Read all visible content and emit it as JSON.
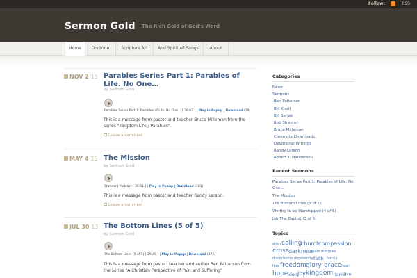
{
  "topbar": {
    "follow": "Follow:",
    "rss": "RSS"
  },
  "header": {
    "title": "Sermon Gold",
    "tagline": "The Rich Gold of God's Word"
  },
  "nav": [
    "Home",
    "Doctrine",
    "Scripture Art",
    "And Spiritual Songs",
    "About"
  ],
  "posts": [
    {
      "month": "NOV 2",
      "day": "15",
      "title": "Parables Series Part 1: Parables of Life. No One…",
      "byline": "by Sermon Gold",
      "player_text": "Parables Series Part 1: Parables of Life. No One…  [ 36:02 ]",
      "play_popup": "Play in Popup",
      "download": "Download",
      "downloads": "(39)",
      "excerpt": "This is a message from pastor and teacher Bruce Milleman from the series \"Kingdom Life / Parables\".",
      "comment": "Leave a comment"
    },
    {
      "month": "MAY 4",
      "day": "15",
      "title": "The Mission",
      "byline": "by Sermon Gold",
      "player_text": "Standard Podcast  [ 36:51 ]",
      "play_popup": "Play in Popup",
      "download": "Download",
      "downloads": "(103)",
      "excerpt": "This is a message from pastor and teacher Randy Larson.",
      "comment": "Leave a comment"
    },
    {
      "month": "JUL 30",
      "day": "13",
      "title": "The Bottom Lines (5 of 5)",
      "byline": "by Sermon Gold",
      "player_text": "The Bottom Lines (5 of 5)  [ 29:49 ]",
      "play_popup": "Play in Popup",
      "download": "Download",
      "downloads": "(176)",
      "excerpt": "This is a message from pastor, teacher and author Ben Patterson from the series \"A Christian Perspective of Pain and Suffering\"",
      "comment": ""
    }
  ],
  "sidebar": {
    "categories_title": "Categories",
    "categories": [
      "News",
      "Sermons"
    ],
    "subcategories": [
      "Ben Patterson",
      "Bill Knott",
      "Bill Serjak",
      "Bob Streeter",
      "Bruce Milleman",
      "Commute Downloads",
      "Devotional Writings",
      "Randy Larson",
      "Robert T. Henderson"
    ],
    "recent_title": "Recent Sermons",
    "recent": [
      "Parables Series Part 1: Parables of Life. No",
      "One…",
      "The Mission",
      "The Bottom Lines (5 of 5)",
      "Worthy to be Worshipped (4 of 5)",
      "Job The Baptist (3 of 5)"
    ],
    "topics_title": "Topics",
    "topics": [
      "alien",
      "calling",
      "church",
      "compassion",
      "cross",
      "darkness",
      "death",
      "disciples",
      "discipleship",
      "dog",
      "eternity",
      "faith",
      "family",
      "fear",
      "freedom",
      "glory",
      "grace",
      "heart",
      "hope",
      "idols",
      "joy",
      "kingdom",
      "lamb",
      "law"
    ]
  }
}
